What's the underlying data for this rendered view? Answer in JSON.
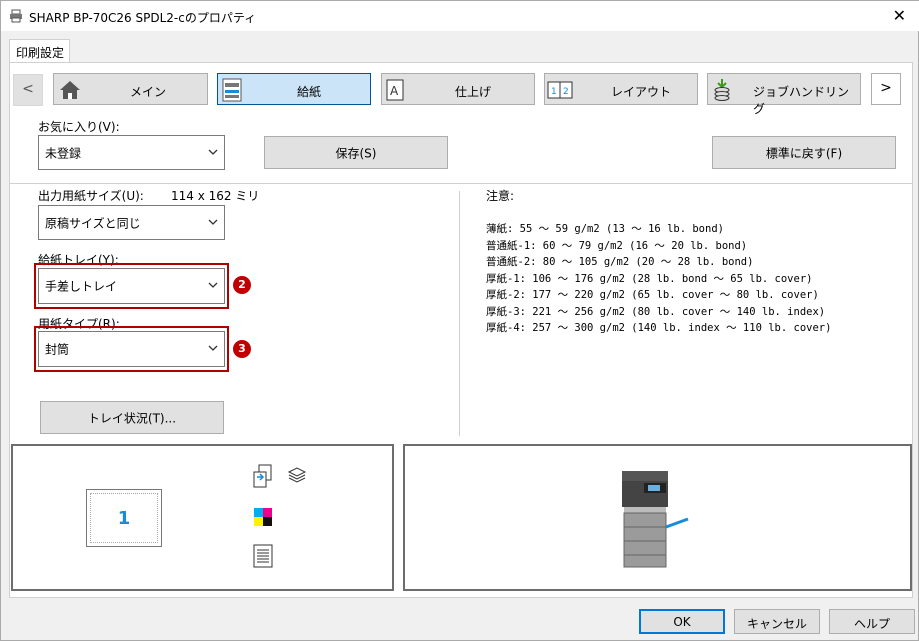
{
  "window": {
    "title": "SHARP BP-70C26 SPDL2-cのプロパティ"
  },
  "tab": {
    "label": "印刷設定"
  },
  "nav": {
    "prev": "<",
    "next": ">",
    "items": [
      {
        "label": "メイン"
      },
      {
        "label": "給紙"
      },
      {
        "label": "仕上げ"
      },
      {
        "label": "レイアウト"
      },
      {
        "label": "ジョブハンドリング"
      }
    ]
  },
  "favorites": {
    "label": "お気に入り(V):",
    "value": "未登録",
    "save_label": "保存(S)",
    "reset_label": "標準に戻す(F)"
  },
  "paper": {
    "size_label": "出力用紙サイズ(U):",
    "size_dims": "114 x 162 ミリ",
    "size_value": "原稿サイズと同じ",
    "tray_label": "給紙トレイ(Y):",
    "tray_value": "手差しトレイ",
    "type_label": "用紙タイプ(R):",
    "type_value": "封筒",
    "tray_status_label": "トレイ状況(T)..."
  },
  "badges": {
    "tray": "2",
    "type": "3"
  },
  "notes": {
    "title": "注意:",
    "lines": [
      "薄紙: 55 ～ 59 g/m2 (13 ～ 16 lb. bond)",
      "普通紙-1: 60 ～ 79 g/m2 (16 ～ 20 lb. bond)",
      "普通紙-2: 80 ～ 105 g/m2 (20 ～ 28 lb. bond)",
      "厚紙-1: 106 ～ 176 g/m2 (28 lb. bond ～ 65 lb. cover)",
      "厚紙-2: 177 ～ 220 g/m2 (65 lb. cover ～ 80 lb. cover)",
      "厚紙-3: 221 ～ 256 g/m2 (80 lb. cover ～ 140 lb. index)",
      "厚紙-4: 257 ～ 300 g/m2 (140 lb. index ～ 110 lb. cover)"
    ]
  },
  "preview": {
    "page_number": "1"
  },
  "footer": {
    "ok": "OK",
    "cancel": "キャンセル",
    "help": "ヘルプ"
  },
  "colors": {
    "highlight": "#b00000",
    "badge": "#c00000",
    "selected_tab": "#cce4f7",
    "page_number": "#1a8bd6"
  }
}
